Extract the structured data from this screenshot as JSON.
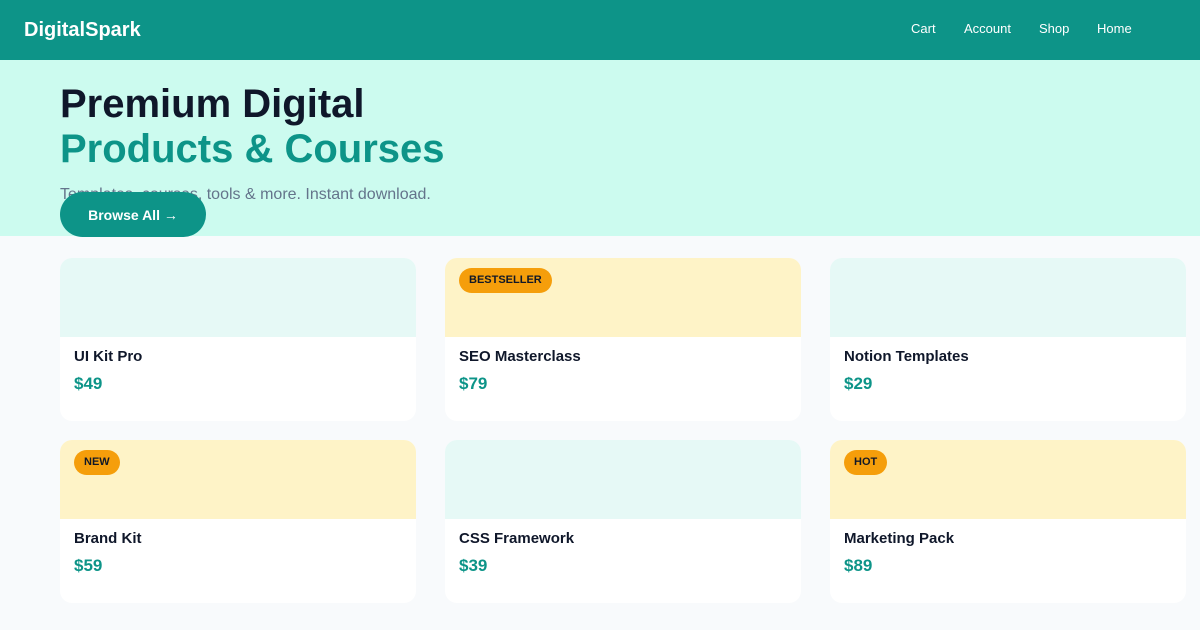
{
  "header": {
    "brand": "DigitalSpark",
    "nav": {
      "cart": "Cart",
      "account": "Account",
      "shop": "Shop",
      "home": "Home"
    }
  },
  "hero": {
    "title_line1": "Premium Digital",
    "title_line2": "Products & Courses",
    "subtitle": "Templates, courses, tools & more. Instant download.",
    "cta_label": "Browse All →"
  },
  "products": [
    {
      "name": "UI Kit Pro",
      "price": "$49",
      "badge": ""
    },
    {
      "name": "SEO Masterclass",
      "price": "$79",
      "badge": "BESTSELLER"
    },
    {
      "name": "Notion Templates",
      "price": "$29",
      "badge": ""
    },
    {
      "name": "Brand Kit",
      "price": "$59",
      "badge": "NEW"
    },
    {
      "name": "CSS Framework",
      "price": "$39",
      "badge": ""
    },
    {
      "name": "Marketing Pack",
      "price": "$89",
      "badge": "HOT"
    }
  ],
  "colors": {
    "primary": "#0d9488",
    "hero_bg": "#ccfbef",
    "badge": "#f59e0b",
    "thumb_plain": "#e6f9f6",
    "thumb_badged": "#fef3c7"
  }
}
